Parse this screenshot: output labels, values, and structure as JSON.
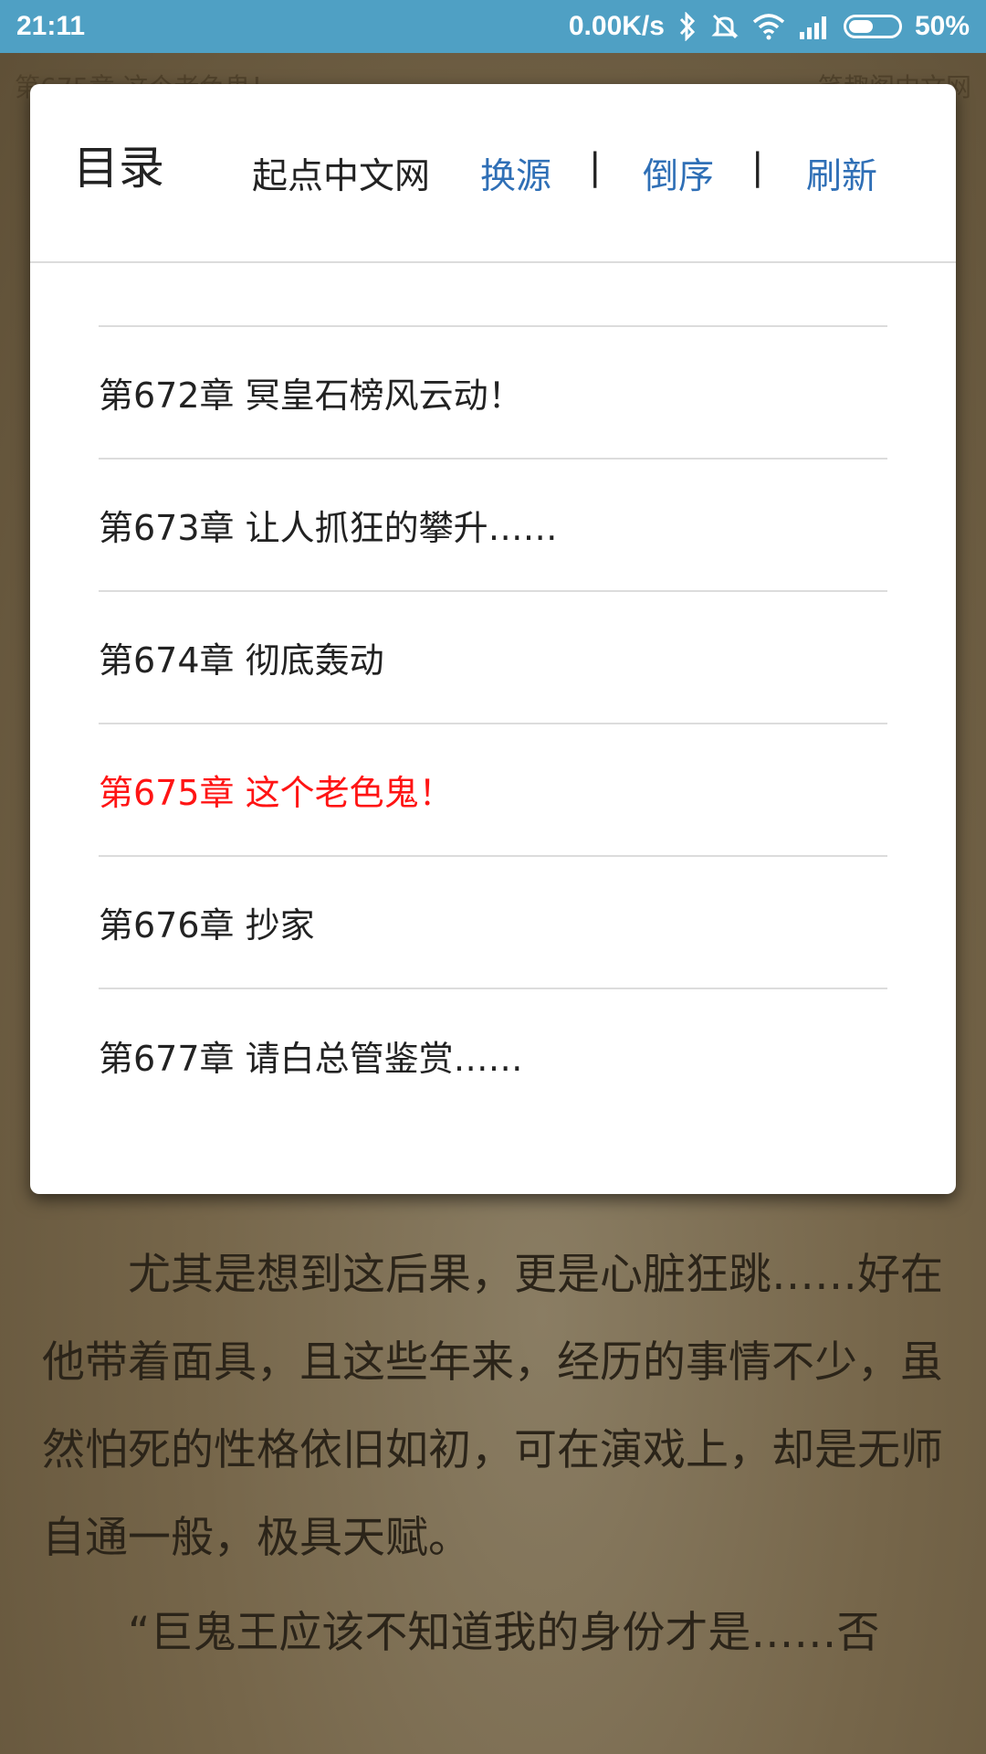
{
  "status_bar": {
    "time": "21:11",
    "network_speed": "0.00K/s",
    "battery_percent": "50%",
    "battery_level": 0.5,
    "icons": [
      "bluetooth-icon",
      "mute-icon",
      "wifi-icon",
      "signal-icon",
      "battery-icon"
    ]
  },
  "reader": {
    "chapter_header": "第675章 这个老色鬼！",
    "site_header": "笔趣阁中文网",
    "paragraphs": [
      "尤其是想到这后果，更是心脏狂跳……好在他带着面具，且这些年来，经历的事情不少，虽然怕死的性格依旧如初，可在演戏上，却是无师自通一般，极具天赋。",
      "“巨鬼王应该不知道我的身份才是……否"
    ]
  },
  "dialog": {
    "title": "目录",
    "source_name": "起点中文网",
    "change_source": "换源",
    "separator": "|",
    "reverse_order": "倒序",
    "refresh": "刷新",
    "chapters": [
      {
        "label": "第672章 冥皇石榜风云动！",
        "current": false
      },
      {
        "label": "第673章 让人抓狂的攀升……",
        "current": false
      },
      {
        "label": "第674章 彻底轰动",
        "current": false
      },
      {
        "label": "第675章 这个老色鬼！",
        "current": true
      },
      {
        "label": "第676章 抄家",
        "current": false
      },
      {
        "label": "第677章 请白总管鉴赏……",
        "current": false
      }
    ]
  },
  "colors": {
    "status_bar": "#4fa0c4",
    "link": "#2f6fb6",
    "current_chapter": "#ff1414"
  }
}
